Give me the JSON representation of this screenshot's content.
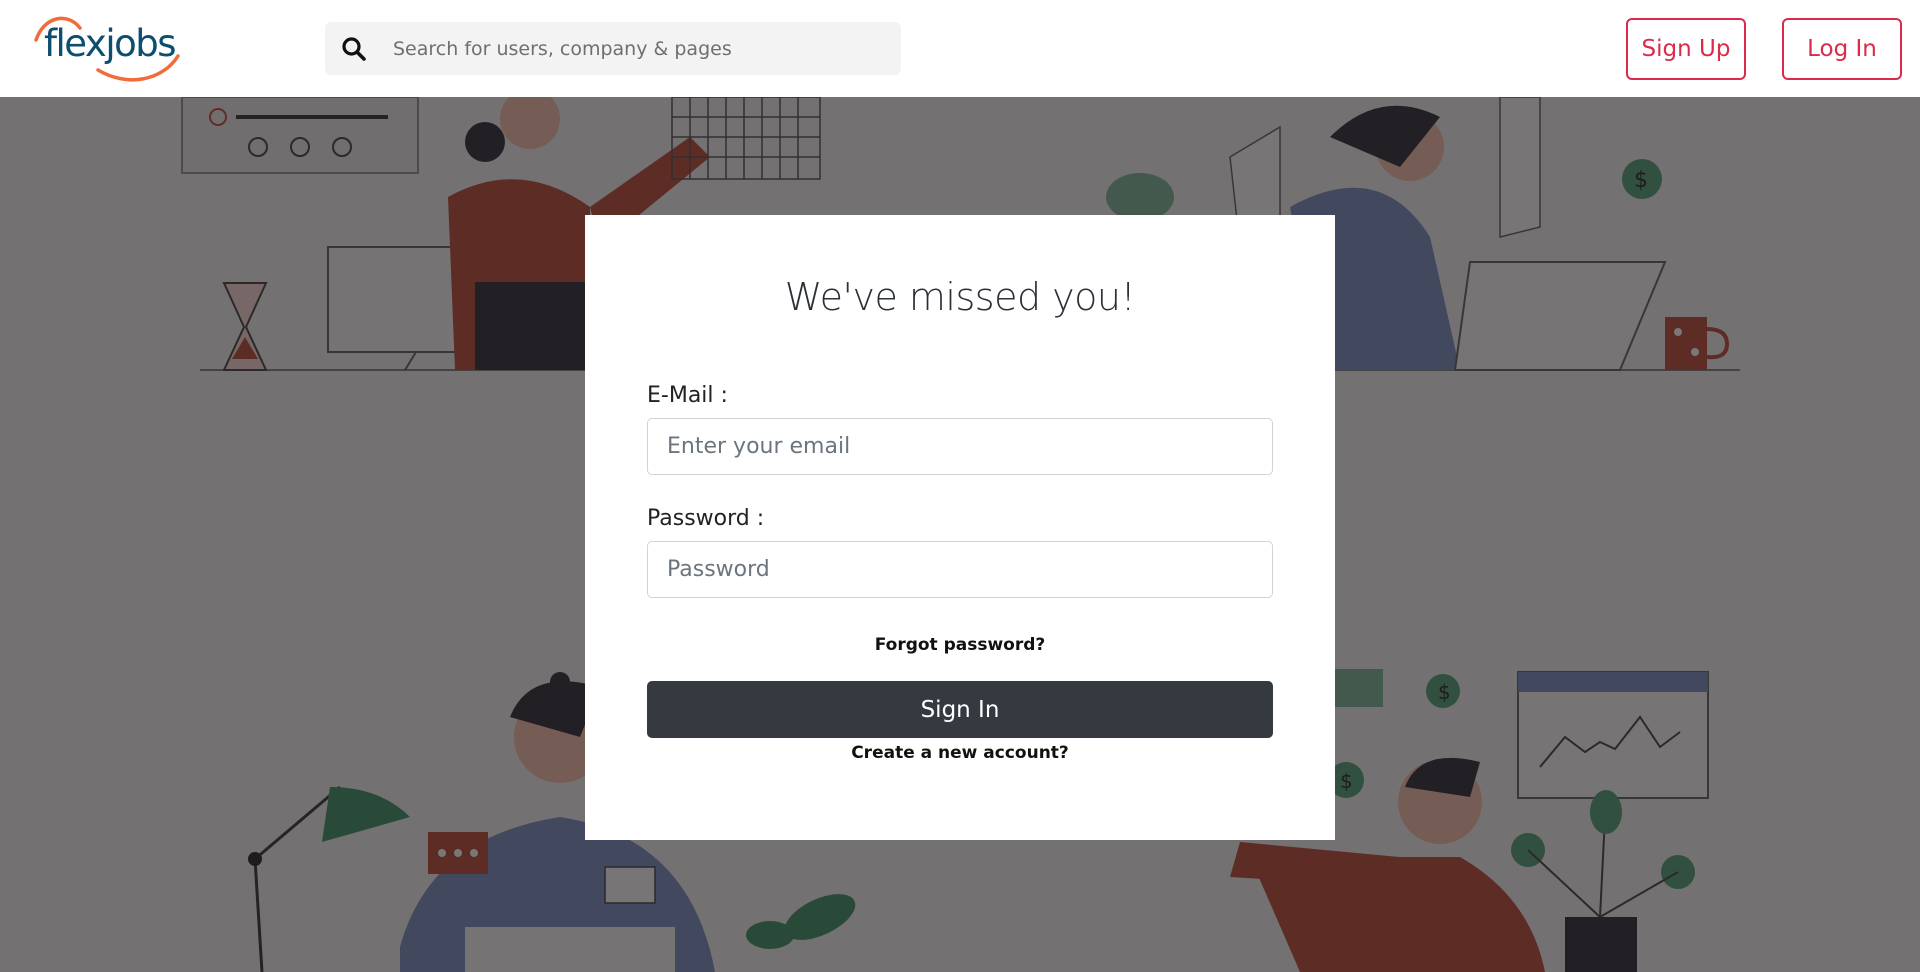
{
  "brand": {
    "name": "flexjobs"
  },
  "search": {
    "placeholder": "Search for users, company & pages"
  },
  "nav": {
    "signup_label": "Sign Up",
    "login_label": "Log In"
  },
  "login": {
    "title": "We've missed you!",
    "email_label": "E-Mail :",
    "email_placeholder": "Enter your email",
    "password_label": "Password :",
    "password_placeholder": "Password",
    "forgot_label": "Forgot password?",
    "signin_label": "Sign In",
    "create_label": "Create a new account?"
  },
  "colors": {
    "accent": "#dc2a4b",
    "dark_button": "#343a40",
    "logo_text": "#0d4d6e",
    "logo_arc": "#f26b3a"
  }
}
